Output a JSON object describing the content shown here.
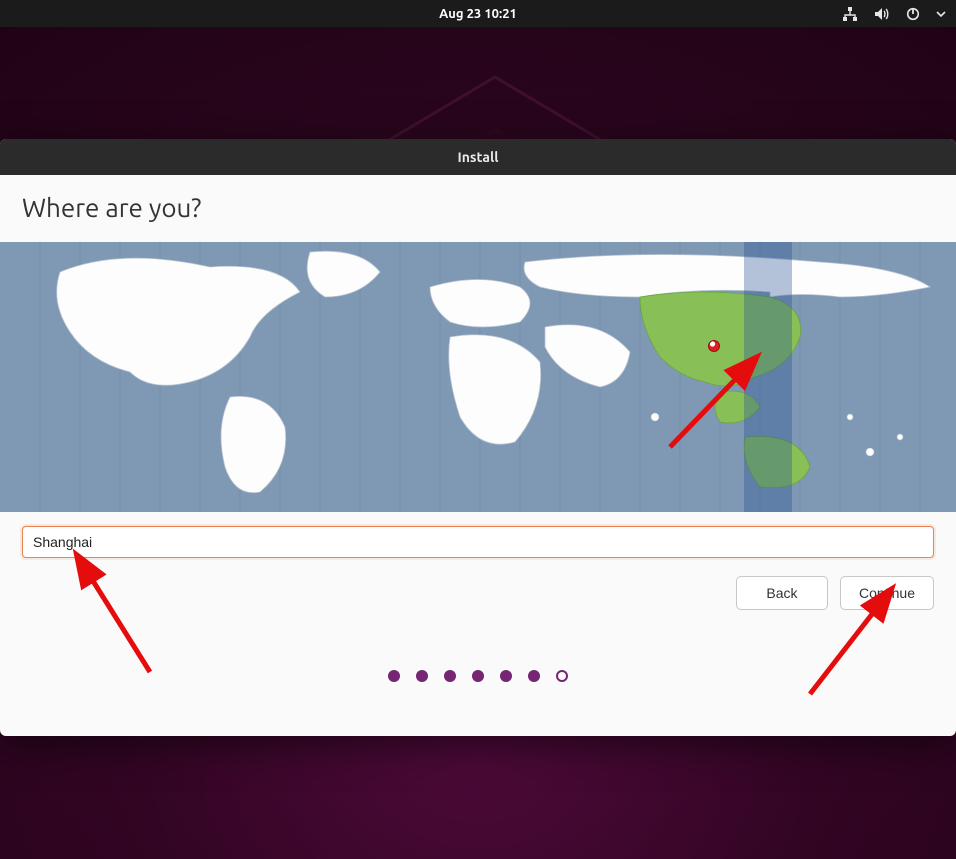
{
  "topbar": {
    "datetime": "Aug 23  10:21"
  },
  "window": {
    "title": "Install"
  },
  "heading": "Where are you?",
  "location": {
    "value": "Shanghai"
  },
  "buttons": {
    "back": "Back",
    "continue": "Continue"
  },
  "progress": {
    "total": 7,
    "filled": 6
  },
  "icons": {
    "network": "network-wired-icon",
    "volume": "volume-icon",
    "power": "power-icon",
    "caret": "caret-down-icon"
  },
  "colors": {
    "accent": "#e95420",
    "dot": "#762572",
    "tz_highlight": "#88c057"
  }
}
